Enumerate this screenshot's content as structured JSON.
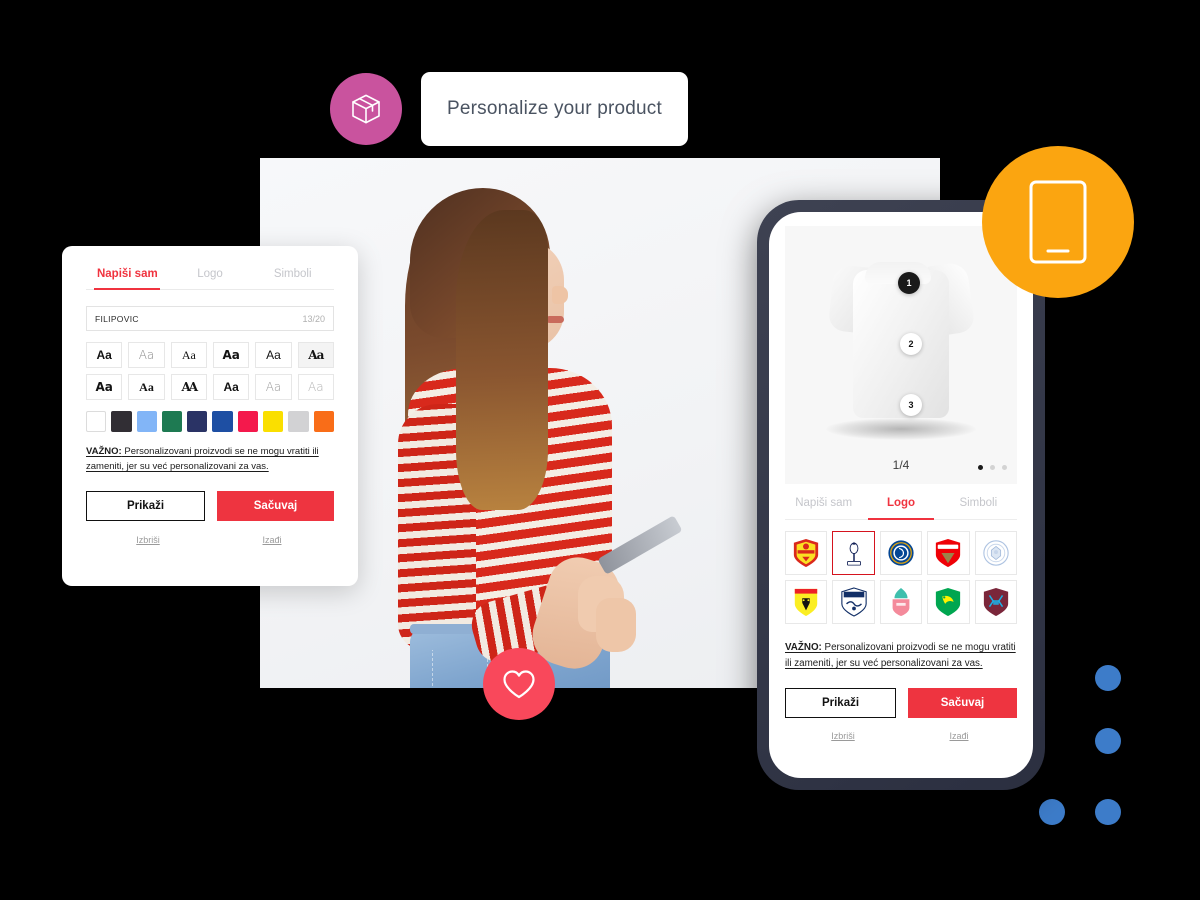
{
  "header": {
    "badge_icon": "package-box-icon",
    "badge_color": "#C9539E",
    "title": "Personalize your product"
  },
  "hero": {
    "alt": "woman-looking-at-phone-photo",
    "background_color": "#F4F5F7",
    "favorite_icon": "heart-icon",
    "favorite_color": "#F9485B"
  },
  "panel": {
    "tabs": [
      {
        "label": "Napiši sam",
        "active": true
      },
      {
        "label": "Logo",
        "active": false
      },
      {
        "label": "Simboli",
        "active": false
      }
    ],
    "text_input": {
      "value": "FILIPOVIC",
      "placeholder": "FILIPOVIC",
      "counter": "13/20"
    },
    "font_tiles": [
      {
        "label": "Aa",
        "selected": false
      },
      {
        "label": "Aa",
        "selected": false
      },
      {
        "label": "Aa",
        "selected": false
      },
      {
        "label": "Aa",
        "selected": false
      },
      {
        "label": "Aa",
        "selected": false
      },
      {
        "label": "Aa",
        "selected": true
      },
      {
        "label": "Aa",
        "selected": false
      },
      {
        "label": "Aa",
        "selected": false
      },
      {
        "label": "AA",
        "selected": false
      },
      {
        "label": "Aa",
        "selected": false
      },
      {
        "label": "Aa",
        "selected": false
      },
      {
        "label": "Aa",
        "selected": false
      }
    ],
    "colors": [
      "#FFFFFF",
      "#312E34",
      "#82B5F7",
      "#1E7A52",
      "#2A3365",
      "#1E4FA3",
      "#F4194C",
      "#FADF00",
      "#D2D2D4",
      "#F96D18"
    ],
    "note": {
      "strong": "VAŽNO:",
      "text": " Personalizovani proizvodi se ne mogu vratiti ili zameniti, jer su već personalizovani za vas."
    },
    "buttons": {
      "preview": "Prikaži",
      "save": "Sačuvaj"
    },
    "links": {
      "delete": "Izbriši",
      "exit": "Izađi"
    }
  },
  "phone": {
    "product": {
      "name": "white-tshirt",
      "markers": [
        "1",
        "2",
        "3"
      ],
      "counter": "1/4",
      "carousel_dots": 3,
      "active_dot": 1
    },
    "tabs": [
      {
        "label": "Napiši sam",
        "active": false
      },
      {
        "label": "Logo",
        "active": true
      },
      {
        "label": "Simboli",
        "active": false
      }
    ],
    "logos": [
      {
        "name": "manchester-united-crest",
        "selected": false,
        "primary": "#DA291C",
        "secondary": "#FBE122"
      },
      {
        "name": "tottenham-hotspur-crest",
        "selected": true,
        "primary": "#FFFFFF",
        "secondary": "#132257"
      },
      {
        "name": "chelsea-crest",
        "selected": false,
        "primary": "#034694",
        "secondary": "#DBA111"
      },
      {
        "name": "arsenal-crest",
        "selected": false,
        "primary": "#EF0107",
        "secondary": "#9C824A"
      },
      {
        "name": "leicester-city-crest",
        "selected": false,
        "primary": "#FFFFFF",
        "secondary": "#003090"
      },
      {
        "name": "watford-crest",
        "selected": false,
        "primary": "#FBEE23",
        "secondary": "#ED2127"
      },
      {
        "name": "west-bromwich-albion-crest",
        "selected": false,
        "primary": "#FFFFFF",
        "secondary": "#122F67"
      },
      {
        "name": "liverpool-crest",
        "selected": false,
        "primary": "#F48A9B",
        "secondary": "#3FBFAD"
      },
      {
        "name": "norwich-city-crest",
        "selected": false,
        "primary": "#00A650",
        "secondary": "#FFF200"
      },
      {
        "name": "west-ham-united-crest",
        "selected": false,
        "primary": "#7A263A",
        "secondary": "#1BB1E7"
      }
    ],
    "note": {
      "strong": "VAŽNO:",
      "text": " Personalizovani proizvodi se ne mogu vratiti ili zameniti, jer su već personalizovani za vas."
    },
    "buttons": {
      "preview": "Prikaži",
      "save": "Sačuvaj"
    },
    "links": {
      "delete": "Izbriši",
      "exit": "Izađi"
    }
  },
  "decorations": {
    "mobile_badge": {
      "icon": "mobile-phone-icon",
      "color": "#FBA510"
    },
    "dots_color": "#3D7CC9",
    "dots_count": 4
  }
}
